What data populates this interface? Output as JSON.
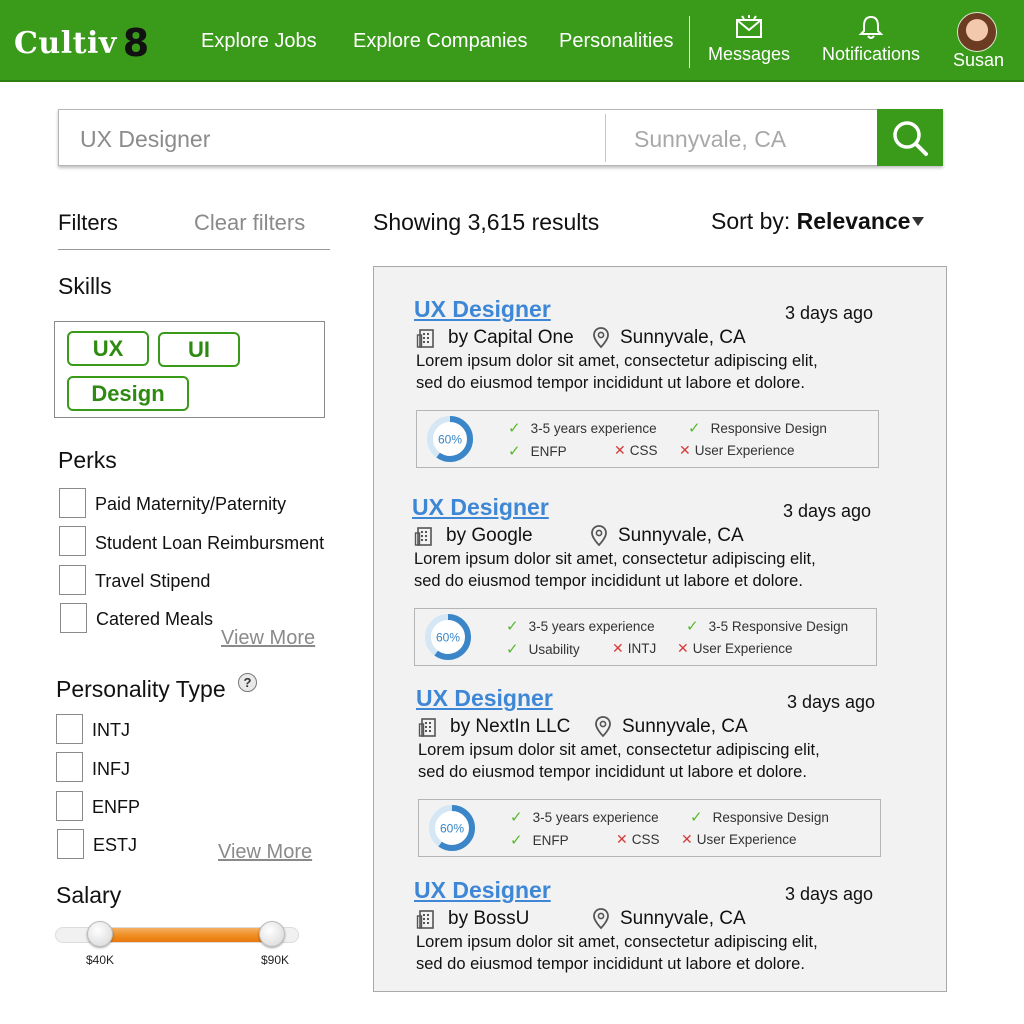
{
  "header": {
    "logo_text": "Cultiv",
    "logo_suffix": "8",
    "nav": [
      "Explore Jobs",
      "Explore Companies",
      "Personalities"
    ],
    "messages_label": "Messages",
    "notifications_label": "Notifications",
    "user_name": "Susan"
  },
  "search": {
    "query_placeholder": "UX Designer",
    "location_placeholder": "Sunnyvale, CA"
  },
  "filters": {
    "title": "Filters",
    "clear_label": "Clear filters",
    "skills_title": "Skills",
    "skills": [
      "UX",
      "UI",
      "Design"
    ],
    "perks_title": "Perks",
    "perks": [
      "Paid Maternity/Paternity",
      "Student Loan Reimbursment",
      "Travel Stipend",
      "Catered Meals"
    ],
    "perks_more": "View More",
    "personality_title": "Personality Type",
    "personality_help": "?",
    "personality_types": [
      "INTJ",
      "INFJ",
      "ENFP",
      "ESTJ"
    ],
    "personality_more": "View More",
    "salary_title": "Salary",
    "salary_min": "$40K",
    "salary_max": "$90K"
  },
  "results": {
    "count_text": "Showing 3,615 results",
    "sort_label": "Sort by:",
    "sort_value": "Relevance",
    "jobs": [
      {
        "title": "UX Designer",
        "posted": "3 days ago",
        "company": "by Capital One",
        "location": "Sunnyvale, CA",
        "desc1": "Lorem ipsum dolor sit amet, consectetur adipiscing elit,",
        "desc2": "sed do eiusmod tempor incididunt ut labore et dolore.",
        "match_pct": 60,
        "match_label": "60%",
        "criteria": [
          {
            "text": "3-5 years experience",
            "met": true
          },
          {
            "text": "Responsive Design",
            "met": true
          },
          {
            "text": "ENFP",
            "met": true
          },
          {
            "text": "CSS",
            "met": false
          },
          {
            "text": "User Experience",
            "met": false
          }
        ]
      },
      {
        "title": "UX Designer",
        "posted": "3 days ago",
        "company": "by Google",
        "location": "Sunnyvale, CA",
        "desc1": "Lorem ipsum dolor sit amet, consectetur adipiscing elit,",
        "desc2": "sed do eiusmod tempor incididunt ut labore et dolore.",
        "match_pct": 60,
        "match_label": "60%",
        "criteria": [
          {
            "text": "3-5 years experience",
            "met": true
          },
          {
            "text": "3-5 Responsive Design",
            "met": true
          },
          {
            "text": "Usability",
            "met": true
          },
          {
            "text": "INTJ",
            "met": false
          },
          {
            "text": "User Experience",
            "met": false
          }
        ]
      },
      {
        "title": "UX Designer",
        "posted": "3 days ago",
        "company": "by NextIn LLC",
        "location": "Sunnyvale, CA",
        "desc1": "Lorem ipsum dolor sit amet, consectetur adipiscing elit,",
        "desc2": "sed do eiusmod tempor incididunt ut labore et dolore.",
        "match_pct": 60,
        "match_label": "60%",
        "criteria": [
          {
            "text": "3-5 years experience",
            "met": true
          },
          {
            "text": "Responsive Design",
            "met": true
          },
          {
            "text": "ENFP",
            "met": true
          },
          {
            "text": "CSS",
            "met": false
          },
          {
            "text": "User Experience",
            "met": false
          }
        ]
      },
      {
        "title": "UX Designer",
        "posted": "3 days ago",
        "company": "by BossU",
        "location": "Sunnyvale, CA",
        "desc1": "Lorem ipsum dolor sit amet, consectetur adipiscing elit,",
        "desc2": "sed do eiusmod tempor incididunt ut labore et dolore."
      }
    ]
  },
  "colors": {
    "brand_green": "#3a9a1a",
    "link_blue": "#3d87d6",
    "check_green": "#58b92c",
    "cross_red": "#d83b3b",
    "donut_blue": "#3a86c8",
    "slider_orange": "#ef8a1c"
  },
  "icons": [
    "search-icon",
    "envelope-icon",
    "bell-icon",
    "building-icon",
    "location-pin-icon",
    "help-icon",
    "sort-caret-icon"
  ]
}
